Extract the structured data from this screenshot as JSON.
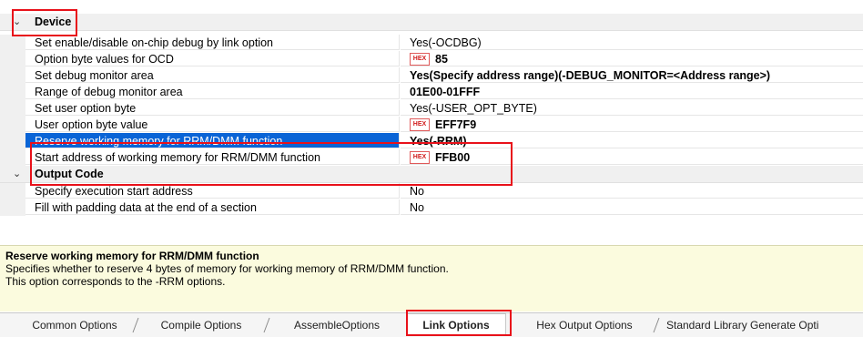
{
  "categories": [
    {
      "name": "Device",
      "chevron": "⌄"
    },
    {
      "name": "Output Code",
      "chevron": "⌄"
    }
  ],
  "device_rows": [
    {
      "label": "Set enable/disable on-chip debug by link option",
      "value": "Yes(-OCDBG)"
    },
    {
      "label": "Option byte values for OCD",
      "value": "85",
      "hex": true,
      "bold": true
    },
    {
      "label": "Set debug monitor area",
      "value": "Yes(Specify address range)(-DEBUG_MONITOR=<Address range>)",
      "bold": true
    },
    {
      "label": "Range of debug monitor area",
      "value": "01E00-01FFF",
      "bold": true
    },
    {
      "label": "Set user option byte",
      "value": "Yes(-USER_OPT_BYTE)"
    },
    {
      "label": "User option byte value",
      "value": "EFF7F9",
      "hex": true,
      "bold": true
    },
    {
      "label": "Reserve working memory for RRM/DMM function",
      "value": "Yes(-RRM)",
      "bold": true,
      "selected": true
    },
    {
      "label": "Start address of working memory for RRM/DMM function",
      "value": "FFB00",
      "hex": true,
      "bold": true
    }
  ],
  "output_rows": [
    {
      "label": "Specify execution start address",
      "value": "No"
    },
    {
      "label": "Fill with padding data at the end of a section",
      "value": "No"
    }
  ],
  "hex_badge": "HEX",
  "description": {
    "title": "Reserve working memory for RRM/DMM function",
    "line1": "Specifies whether to reserve 4 bytes of memory for working memory of RRM/DMM function.",
    "line2": "This option corresponds to the -RRM options."
  },
  "tabs": [
    {
      "label": "Common Options"
    },
    {
      "label": "Compile Options"
    },
    {
      "label": "AssembleOptions"
    },
    {
      "label": "Link Options",
      "active": true
    },
    {
      "label": "Hex Output Options"
    },
    {
      "label": "Standard Library Generate Opti"
    }
  ],
  "colors": {
    "highlight": "#e8111a",
    "selection": "#0a64d6",
    "description_bg": "#fbfbde"
  }
}
